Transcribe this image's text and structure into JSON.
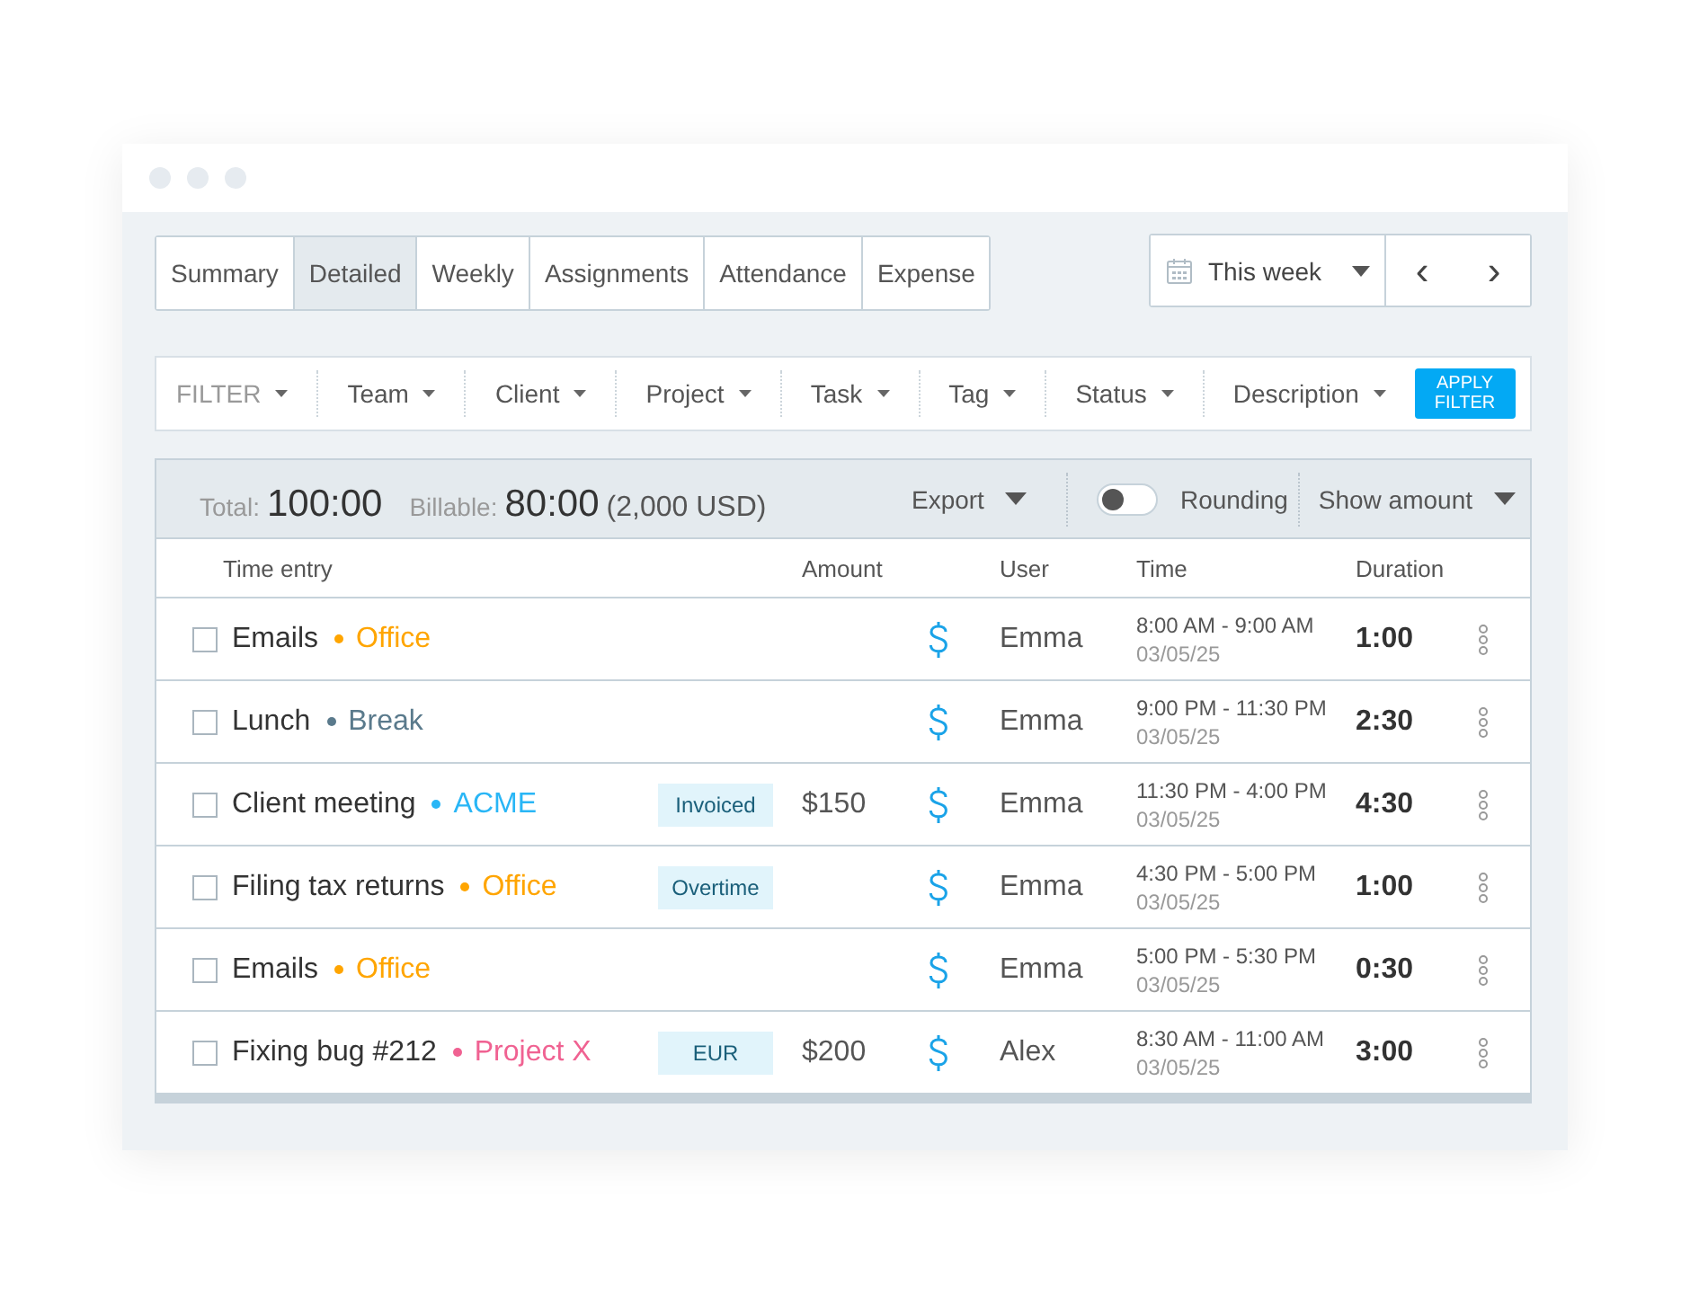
{
  "tabs": [
    {
      "label": "Summary",
      "selected": false
    },
    {
      "label": "Detailed",
      "selected": true
    },
    {
      "label": "Weekly",
      "selected": false
    },
    {
      "label": "Assignments",
      "selected": false
    },
    {
      "label": "Attendance",
      "selected": false
    },
    {
      "label": "Expense",
      "selected": false
    }
  ],
  "date_range": {
    "label": "This week",
    "prev": "‹",
    "next": "›"
  },
  "filters": [
    {
      "label": "FILTER",
      "kind": "title"
    },
    {
      "label": "Team",
      "kind": "filter"
    },
    {
      "label": "Client",
      "kind": "filter"
    },
    {
      "label": "Project",
      "kind": "filter"
    },
    {
      "label": "Task",
      "kind": "filter"
    },
    {
      "label": "Tag",
      "kind": "filter"
    },
    {
      "label": "Status",
      "kind": "filter"
    },
    {
      "label": "Description",
      "kind": "filter"
    }
  ],
  "apply_button": "APPLY FILTER",
  "summary": {
    "total_label": "Total:",
    "total": "100:00",
    "billable_label": "Billable:",
    "billable": "80:00",
    "amount": "(2,000 USD)",
    "export": "Export",
    "rounding": {
      "label": "Rounding",
      "on": false
    },
    "show_amount": "Show amount"
  },
  "columns": [
    "Time entry",
    "Amount",
    "User",
    "Time",
    "Duration"
  ],
  "rows": [
    {
      "checked": false,
      "description": "Emails",
      "project": "Office",
      "color": "#ffa500",
      "tag": null,
      "amount": null,
      "user": "Emma",
      "time": "8:00 AM - 9:00 AM",
      "date": "03/05/25",
      "duration": "1:00"
    },
    {
      "checked": false,
      "description": "Lunch",
      "project": "Break",
      "color": "#5a7a8c",
      "tag": null,
      "amount": null,
      "user": "Emma",
      "time": "9:00 PM - 11:30 PM",
      "date": "03/05/25",
      "duration": "2:30"
    },
    {
      "checked": false,
      "description": "Client meeting",
      "project": "ACME",
      "color": "#29b6f6",
      "tag": "Invoiced",
      "amount": "$150",
      "user": "Emma",
      "time": "11:30 PM - 4:00 PM",
      "date": "03/05/25",
      "duration": "4:30"
    },
    {
      "checked": false,
      "description": "Filing tax returns",
      "project": "Office",
      "color": "#ffa500",
      "tag": "Overtime",
      "amount": null,
      "user": "Emma",
      "time": "4:30 PM - 5:00 PM",
      "date": "03/05/25",
      "duration": "1:00"
    },
    {
      "checked": false,
      "description": "Emails",
      "project": "Office",
      "color": "#ffa500",
      "tag": null,
      "amount": null,
      "user": "Emma",
      "time": "5:00 PM - 5:30 PM",
      "date": "03/05/25",
      "duration": "0:30"
    },
    {
      "checked": false,
      "description": "Fixing bug #212",
      "project": "Project X",
      "color": "#f06292",
      "tag": "EUR",
      "amount": "$200",
      "user": "Alex",
      "time": "8:30 AM - 11:00 AM",
      "date": "03/05/25",
      "duration": "3:00"
    }
  ]
}
